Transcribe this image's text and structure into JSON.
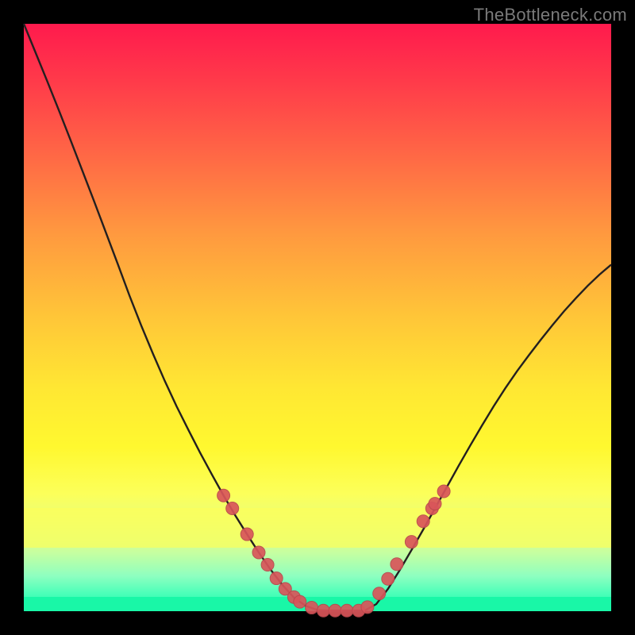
{
  "watermark": "TheBottleneck.com",
  "colors": {
    "frame": "#000000",
    "curve_stroke": "#231f20",
    "marker_fill": "#d9555a",
    "marker_stroke": "#b8474c",
    "gradient_top": "#ff1a4d",
    "gradient_bottom": "#19f7a7"
  },
  "chart_data": {
    "type": "line",
    "title": "",
    "xlabel": "",
    "ylabel": "",
    "xlim": [
      0,
      1
    ],
    "ylim": [
      0,
      1
    ],
    "x": [
      0.0,
      0.02,
      0.04,
      0.06,
      0.08,
      0.1,
      0.12,
      0.14,
      0.16,
      0.18,
      0.2,
      0.22,
      0.24,
      0.26,
      0.28,
      0.3,
      0.32,
      0.34,
      0.36,
      0.38,
      0.4,
      0.42,
      0.44,
      0.46,
      0.48,
      0.5,
      0.52,
      0.54,
      0.56,
      0.58,
      0.6,
      0.62,
      0.64,
      0.66,
      0.68,
      0.7,
      0.72,
      0.74,
      0.76,
      0.78,
      0.8,
      0.82,
      0.84,
      0.86,
      0.88,
      0.9,
      0.92,
      0.94,
      0.96,
      0.98,
      1.0
    ],
    "values": [
      1.0,
      0.951,
      0.902,
      0.852,
      0.801,
      0.749,
      0.697,
      0.644,
      0.591,
      0.537,
      0.486,
      0.438,
      0.392,
      0.349,
      0.309,
      0.27,
      0.233,
      0.197,
      0.163,
      0.131,
      0.1,
      0.071,
      0.045,
      0.023,
      0.009,
      0.002,
      0.001,
      0.001,
      0.001,
      0.001,
      0.012,
      0.038,
      0.07,
      0.104,
      0.139,
      0.175,
      0.211,
      0.247,
      0.282,
      0.316,
      0.349,
      0.38,
      0.409,
      0.436,
      0.462,
      0.487,
      0.511,
      0.533,
      0.554,
      0.573,
      0.59
    ],
    "series": [
      {
        "name": "bottleneck-curve",
        "x": [
          0.0,
          0.02,
          0.04,
          0.06,
          0.08,
          0.1,
          0.12,
          0.14,
          0.16,
          0.18,
          0.2,
          0.22,
          0.24,
          0.26,
          0.28,
          0.3,
          0.32,
          0.34,
          0.36,
          0.38,
          0.4,
          0.42,
          0.44,
          0.46,
          0.48,
          0.5,
          0.52,
          0.54,
          0.56,
          0.58,
          0.6,
          0.62,
          0.64,
          0.66,
          0.68,
          0.7,
          0.72,
          0.74,
          0.76,
          0.78,
          0.8,
          0.82,
          0.84,
          0.86,
          0.88,
          0.9,
          0.92,
          0.94,
          0.96,
          0.98,
          1.0
        ],
        "y": [
          1.0,
          0.951,
          0.902,
          0.852,
          0.801,
          0.749,
          0.697,
          0.644,
          0.591,
          0.537,
          0.486,
          0.438,
          0.392,
          0.349,
          0.309,
          0.27,
          0.233,
          0.197,
          0.163,
          0.131,
          0.1,
          0.071,
          0.045,
          0.023,
          0.009,
          0.002,
          0.001,
          0.001,
          0.001,
          0.001,
          0.012,
          0.038,
          0.07,
          0.104,
          0.139,
          0.175,
          0.211,
          0.247,
          0.282,
          0.316,
          0.349,
          0.38,
          0.409,
          0.436,
          0.462,
          0.487,
          0.511,
          0.533,
          0.554,
          0.573,
          0.59
        ]
      }
    ],
    "markers": [
      {
        "x": 0.34,
        "y": 0.197
      },
      {
        "x": 0.355,
        "y": 0.175
      },
      {
        "x": 0.38,
        "y": 0.131
      },
      {
        "x": 0.4,
        "y": 0.1
      },
      {
        "x": 0.415,
        "y": 0.079
      },
      {
        "x": 0.43,
        "y": 0.056
      },
      {
        "x": 0.445,
        "y": 0.038
      },
      {
        "x": 0.46,
        "y": 0.024
      },
      {
        "x": 0.47,
        "y": 0.016
      },
      {
        "x": 0.49,
        "y": 0.006
      },
      {
        "x": 0.51,
        "y": 0.001
      },
      {
        "x": 0.53,
        "y": 0.001
      },
      {
        "x": 0.55,
        "y": 0.001
      },
      {
        "x": 0.57,
        "y": 0.001
      },
      {
        "x": 0.585,
        "y": 0.007
      },
      {
        "x": 0.605,
        "y": 0.03
      },
      {
        "x": 0.62,
        "y": 0.055
      },
      {
        "x": 0.635,
        "y": 0.08
      },
      {
        "x": 0.66,
        "y": 0.118
      },
      {
        "x": 0.68,
        "y": 0.153
      },
      {
        "x": 0.695,
        "y": 0.175
      },
      {
        "x": 0.7,
        "y": 0.183
      },
      {
        "x": 0.715,
        "y": 0.204
      }
    ],
    "annotations": []
  }
}
